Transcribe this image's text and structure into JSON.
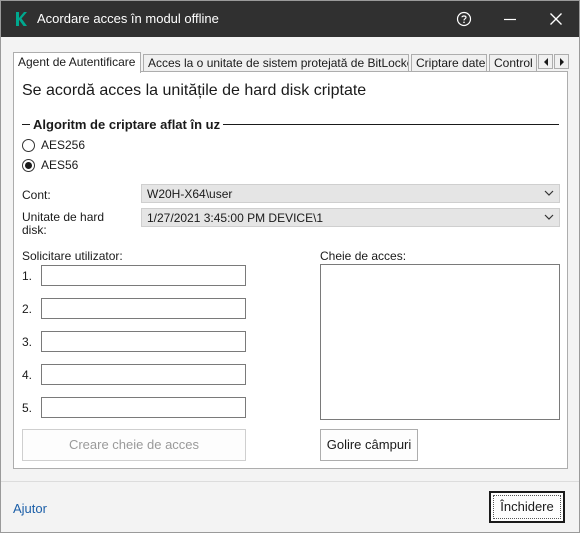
{
  "window": {
    "title": "Acordare acces în modul offline"
  },
  "tabs": [
    {
      "label": "Agent de Autentificare",
      "active": true
    },
    {
      "label": "Acces la o unitate de sistem protejată de BitLocker",
      "active": false
    },
    {
      "label": "Criptare date",
      "active": false
    },
    {
      "label": "Control",
      "active": false
    }
  ],
  "panel": {
    "heading": "Se acordă acces la unitățile de hard disk criptate",
    "algorithm_group": {
      "label": "Algoritm de criptare aflat în uz",
      "options": [
        {
          "label": "AES256",
          "selected": false
        },
        {
          "label": "AES56",
          "selected": true
        }
      ]
    },
    "account": {
      "label": "Cont:",
      "value": "W20H-X64\\user"
    },
    "drive": {
      "label_line1": "Unitate de hard",
      "label_line2": "disk:",
      "value": "1/27/2021 3:45:00 PM  DEVICE\\1"
    },
    "user_request": {
      "label": "Solicitare utilizator:",
      "fields": [
        {
          "number": "1.",
          "value": ""
        },
        {
          "number": "2.",
          "value": ""
        },
        {
          "number": "3.",
          "value": ""
        },
        {
          "number": "4.",
          "value": ""
        },
        {
          "number": "5.",
          "value": ""
        }
      ]
    },
    "access_key": {
      "label": "Cheie de acces:",
      "value": ""
    },
    "create_key_button": "Creare cheie de acces",
    "clear_fields_button": "Golire câmpuri"
  },
  "footer": {
    "help_link": "Ajutor",
    "close_button": "Închidere"
  },
  "colors": {
    "titlebar": "#303030",
    "accent_logo": "#00a88e",
    "link": "#1c5fa8"
  },
  "icons": {
    "app": "kaspersky-logo-icon",
    "help": "question-circle-icon",
    "minimize": "minimize-icon",
    "close": "close-icon"
  }
}
